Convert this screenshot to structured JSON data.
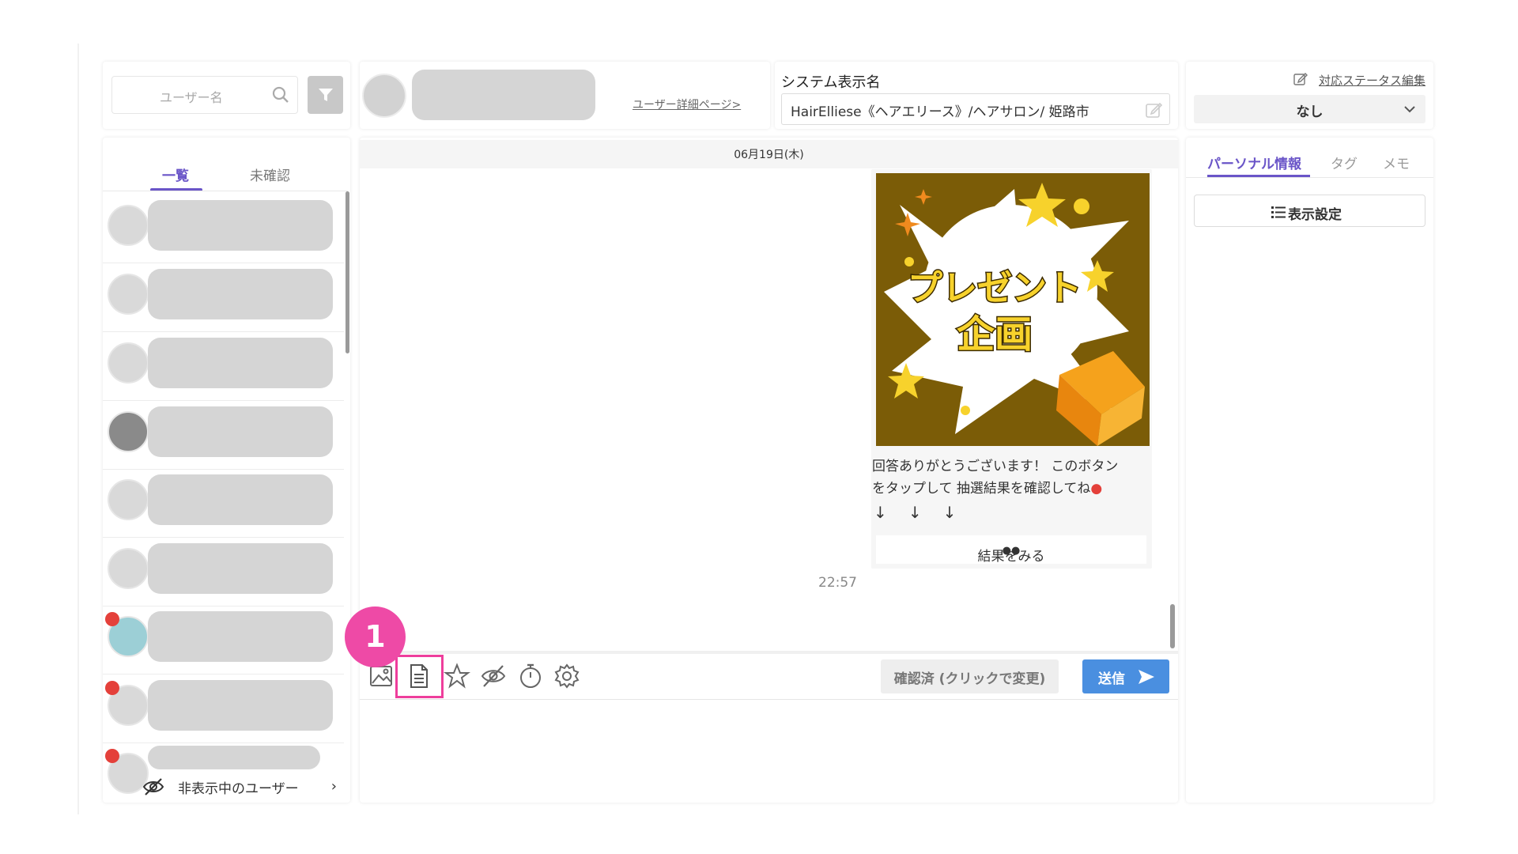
{
  "search": {
    "placeholder": "ユーザー名"
  },
  "user_header": {
    "detail_link": "ユーザー詳細ページ>"
  },
  "system": {
    "label": "システム表示名",
    "value": "HairElliese《ヘアエリース》/ヘアサロン/ 姫路市"
  },
  "status": {
    "edit_label": "対応ステータス編集",
    "selected": "なし"
  },
  "list": {
    "tabs": [
      "一覧",
      "未確認"
    ],
    "active_tab": "一覧",
    "hidden_users_label": "非表示中のユーザー",
    "unread_rows": [
      7,
      8,
      9
    ]
  },
  "chat": {
    "date": "06月19日(木)",
    "promo_text": [
      "プレゼント",
      "企画"
    ],
    "message_line1": "回答ありがとうございます！ このボタン",
    "message_line2": "をタップして 抽選結果を確認してね",
    "arrows": "↓   ↓   ↓",
    "result_button": "結果をみる",
    "time": "22:57"
  },
  "toolbar": {
    "icons": [
      "image-icon",
      "template-icon",
      "star-icon",
      "hide-eye-icon",
      "timer-icon",
      "gear-icon"
    ],
    "confirm_label": "確認済 (クリックで変更)",
    "send_label": "送信"
  },
  "annotation": {
    "number": "1",
    "color": "#ee3e9c"
  },
  "right_panel": {
    "tabs": [
      "パーソナル情報",
      "タグ",
      "メモ"
    ],
    "display_settings": "表示設定"
  },
  "colors": {
    "accent": "#6a55c8",
    "send": "#4a8fe0",
    "unread_dot": "#e4403a"
  }
}
